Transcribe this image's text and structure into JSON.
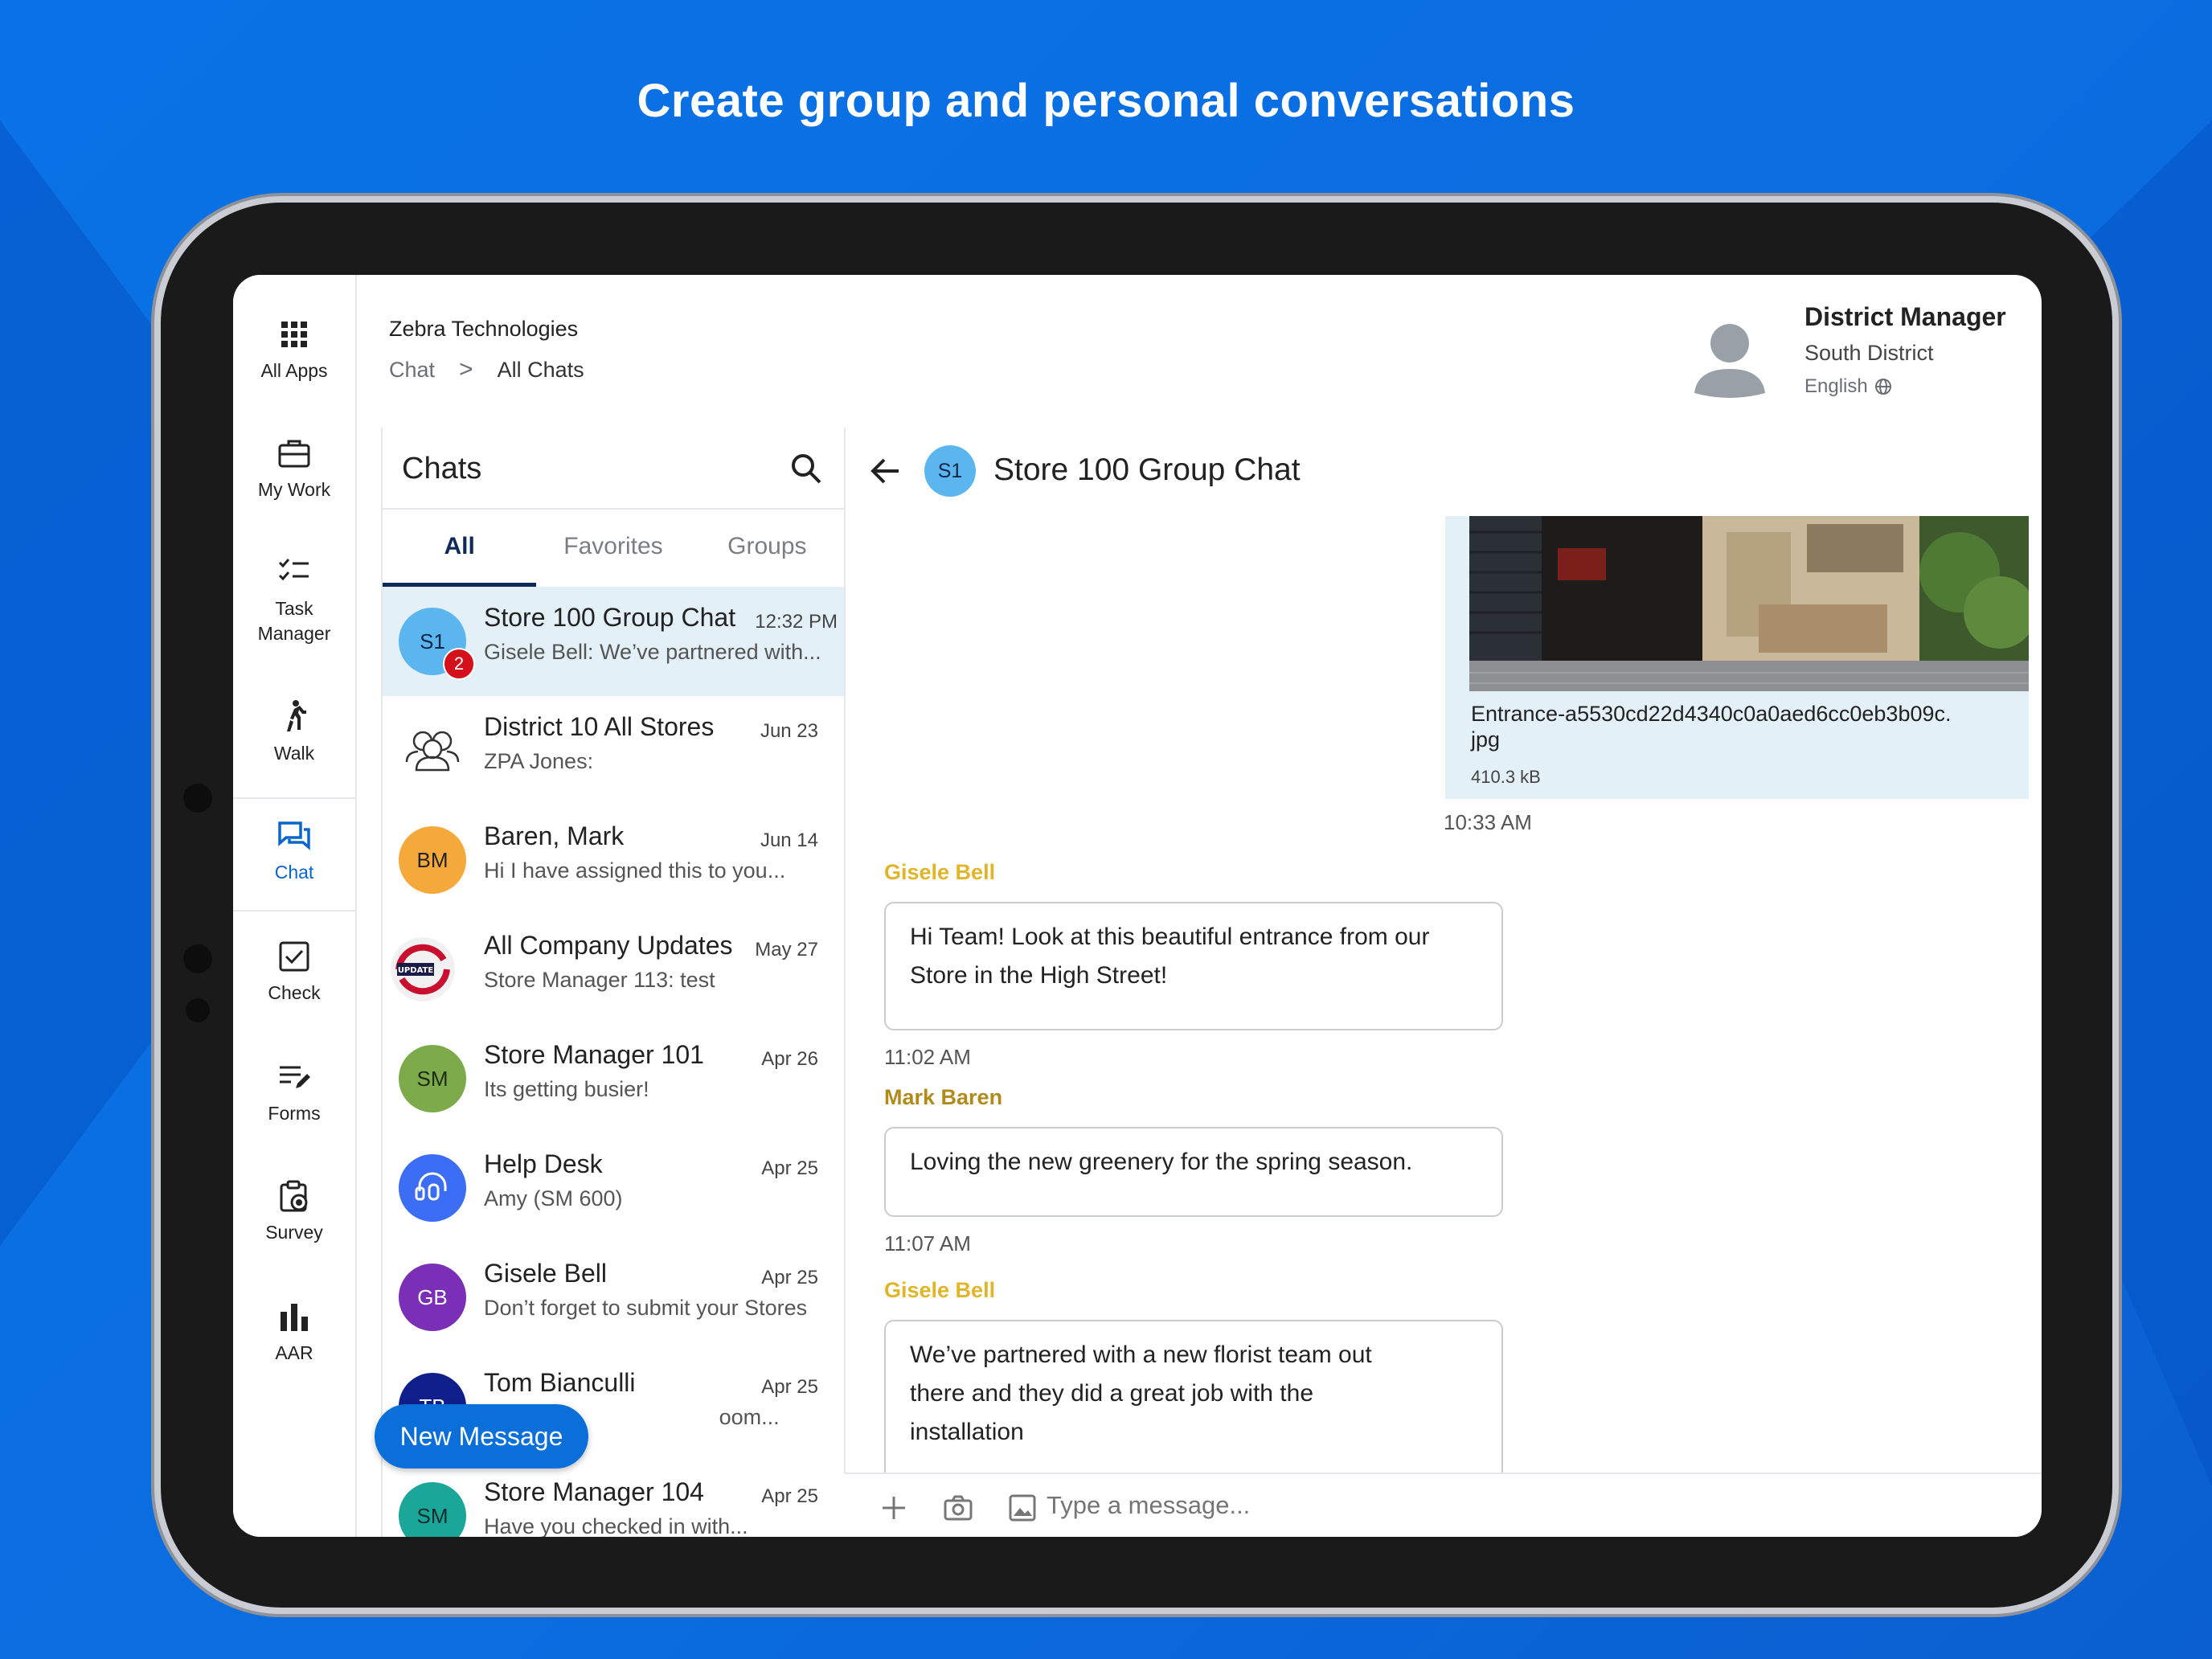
{
  "headline": "Create group and personal conversations",
  "colors": {
    "accent": "#0a6fd8",
    "background": "#0a6de0",
    "active_nav": "#0a66c8",
    "gisele": "#e0b52a",
    "mark": "#b08a1a"
  },
  "nav": [
    {
      "label": "All Apps",
      "icon": "grid-icon"
    },
    {
      "label": "My Work",
      "icon": "briefcase-icon"
    },
    {
      "label": "Task Manager",
      "icon": "checklist-icon"
    },
    {
      "label": "Walk",
      "icon": "walk-icon"
    },
    {
      "label": "Chat",
      "icon": "chat-icon",
      "active": true
    },
    {
      "label": "Check",
      "icon": "checkbox-icon"
    },
    {
      "label": "Forms",
      "icon": "forms-icon"
    },
    {
      "label": "Survey",
      "icon": "survey-icon"
    },
    {
      "label": "AAR",
      "icon": "bar-chart-icon"
    }
  ],
  "header": {
    "org": "Zebra Technologies",
    "breadcrumb": {
      "parent": "Chat",
      "separator": ">",
      "current": "All Chats"
    },
    "profile": {
      "title": "District Manager",
      "subtitle": "South District",
      "language": "English"
    }
  },
  "chat_list": {
    "title": "Chats",
    "tabs": [
      "All",
      "Favorites",
      "Groups"
    ],
    "active_tab": "All",
    "rows": [
      {
        "initials": "S1",
        "name": "Store 100 Group Chat",
        "time": "12:32 PM",
        "preview": "Gisele Bell: We’ve partnered with...",
        "badge": "2",
        "color": "#5bb6f0",
        "active": true
      },
      {
        "initials": "",
        "name": "District 10 All Stores",
        "time": "Jun 23",
        "preview": "ZPA Jones:",
        "icon": "group-people-icon"
      },
      {
        "initials": "BM",
        "name": "Baren, Mark",
        "time": "Jun 14",
        "preview": "Hi I have assigned this to you...",
        "color": "#f6a93b"
      },
      {
        "initials": "",
        "name": "All Company Updates",
        "time": "May 27",
        "preview": "Store Manager 113: test",
        "icon": "update-logo-icon"
      },
      {
        "initials": "SM",
        "name": "Store Manager 101",
        "time": "Apr 26",
        "preview": "Its getting busier!",
        "color": "#7daa4a"
      },
      {
        "initials": "",
        "name": "Help Desk",
        "time": "Apr 25",
        "preview": "Amy (SM 600)",
        "icon": "headset-icon",
        "color": "#3b6df5"
      },
      {
        "initials": "GB",
        "name": "Gisele Bell",
        "time": "Apr 25",
        "preview": "Don’t forget to submit your Stores",
        "color": "#7a2fb6"
      },
      {
        "initials": "TB",
        "name": "Tom Bianculli",
        "time": "Apr 25",
        "preview": "I nee                               oom...",
        "color": "#0f1f8c"
      },
      {
        "initials": "SM",
        "name": "Store Manager 104",
        "time": "Apr 25",
        "preview": "Have you checked in with...",
        "color": "#1aa79a"
      }
    ],
    "new_message": "New Message"
  },
  "conversation": {
    "initials": "S1",
    "title": "Store 100 Group Chat",
    "attachment": {
      "filename": "Entrance-a5530cd22d4340c0a0aed6cc0eb3b09c.jpg",
      "size": "410.3 kB",
      "time": "10:33 AM"
    },
    "messages": [
      {
        "sender": "Gisele Bell",
        "text": "Hi Team! Look at this beautiful entrance from our Store in the High Street!",
        "time": "11:02 AM"
      },
      {
        "sender": "Mark Baren",
        "text": "Loving the new greenery for the spring season.",
        "time": "11:07 AM"
      },
      {
        "sender": "Gisele Bell",
        "text": "We’ve partnered with a new florist team out there and they did a great job with the installation",
        "time": ""
      }
    ],
    "composer_placeholder": "Type a message..."
  }
}
